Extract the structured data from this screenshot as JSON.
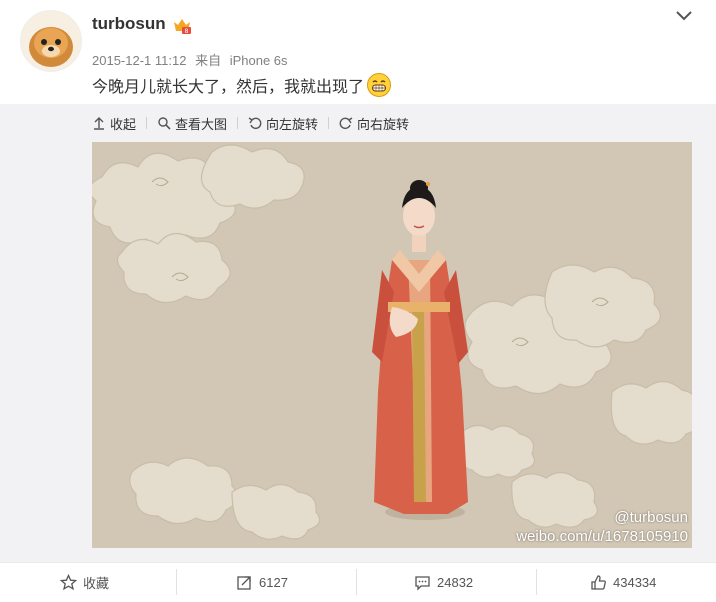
{
  "post": {
    "username": "turbosun",
    "timestamp": "2015-12-1 11:12",
    "source_prefix": "来自",
    "source": "iPhone 6s",
    "text": "今晚月儿就长大了，然后，我就出现了"
  },
  "media_toolbar": {
    "collapse": "收起",
    "view_large": "查看大图",
    "rotate_left": "向左旋转",
    "rotate_right": "向右旋转"
  },
  "image": {
    "watermark_handle": "@turbosun",
    "watermark_url": "weibo.com/u/1678105910"
  },
  "actions": {
    "favorite_label": "收藏",
    "repost_count": "6127",
    "comment_count": "24832",
    "like_count": "434334"
  },
  "icons": [
    "dropdown-caret-icon",
    "vip-badge-icon",
    "grin-emoji-icon",
    "collapse-icon",
    "magnifier-icon",
    "rotate-left-icon",
    "rotate-right-icon",
    "star-icon",
    "repost-icon",
    "comment-icon",
    "like-icon"
  ],
  "colors": {
    "text": "#333333",
    "meta": "#808080",
    "panel": "#f2f2f5",
    "photo_bg": "#d2c7b5",
    "robe": "#d8614a"
  }
}
